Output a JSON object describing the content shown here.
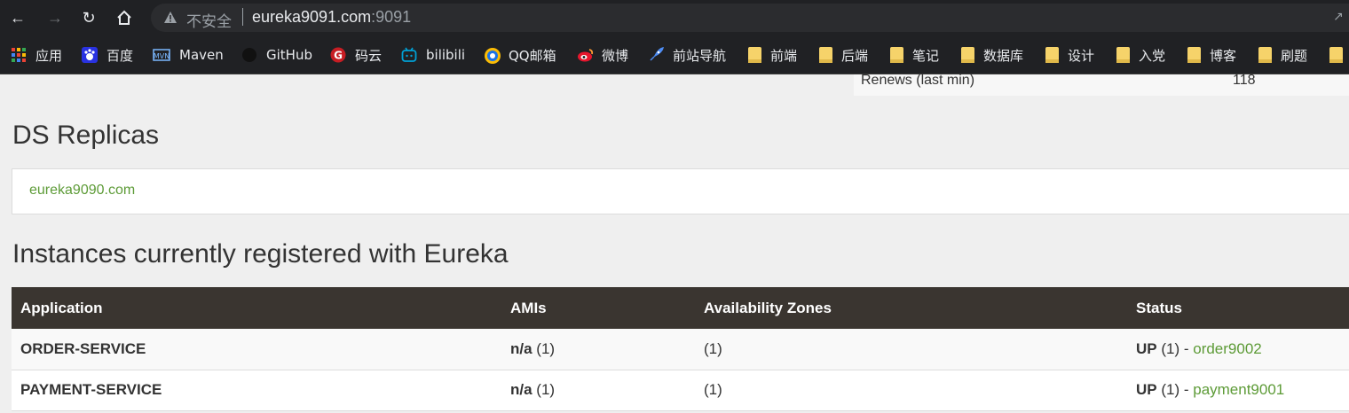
{
  "browser": {
    "insecure_label": "不安全",
    "url_host": "eureka9091.com",
    "url_port": ":9091"
  },
  "bookmarks": [
    {
      "label": "应用",
      "icon": "apps-grid-icon"
    },
    {
      "label": "百度",
      "icon": "baidu-icon"
    },
    {
      "label": "Maven",
      "icon": "maven-icon"
    },
    {
      "label": "GitHub",
      "icon": "github-icon"
    },
    {
      "label": "码云",
      "icon": "gitee-icon"
    },
    {
      "label": "bilibili",
      "icon": "bilibili-icon"
    },
    {
      "label": "QQ邮箱",
      "icon": "qqmail-icon"
    },
    {
      "label": "微博",
      "icon": "weibo-icon"
    },
    {
      "label": "前站导航",
      "icon": "rocket-icon"
    },
    {
      "label": "前端",
      "icon": "folder-icon"
    },
    {
      "label": "后端",
      "icon": "folder-icon"
    },
    {
      "label": "笔记",
      "icon": "folder-icon"
    },
    {
      "label": "数据库",
      "icon": "folder-icon"
    },
    {
      "label": "设计",
      "icon": "folder-icon"
    },
    {
      "label": "入党",
      "icon": "folder-icon"
    },
    {
      "label": "博客",
      "icon": "folder-icon"
    },
    {
      "label": "刷题",
      "icon": "folder-icon"
    }
  ],
  "stats": {
    "label": "Renews (last min)",
    "value": "118"
  },
  "ds_replicas": {
    "heading": "DS Replicas",
    "link": "eureka9090.com"
  },
  "instances": {
    "heading": "Instances currently registered with Eureka",
    "columns": [
      "Application",
      "AMIs",
      "Availability Zones",
      "Status"
    ],
    "rows": [
      {
        "application": "ORDER-SERVICE",
        "ami_bold": "n/a",
        "ami_count": " (1)",
        "zones": "(1)",
        "status_bold": "UP",
        "status_count": " (1) - ",
        "instance": "order9002"
      },
      {
        "application": "PAYMENT-SERVICE",
        "ami_bold": "n/a",
        "ami_count": " (1)",
        "zones": "(1)",
        "status_bold": "UP",
        "status_count": " (1) - ",
        "instance": "payment9001"
      }
    ]
  },
  "colors": {
    "link": "#5d9b37",
    "table_header": "#3a3530",
    "chrome": "#202124"
  }
}
